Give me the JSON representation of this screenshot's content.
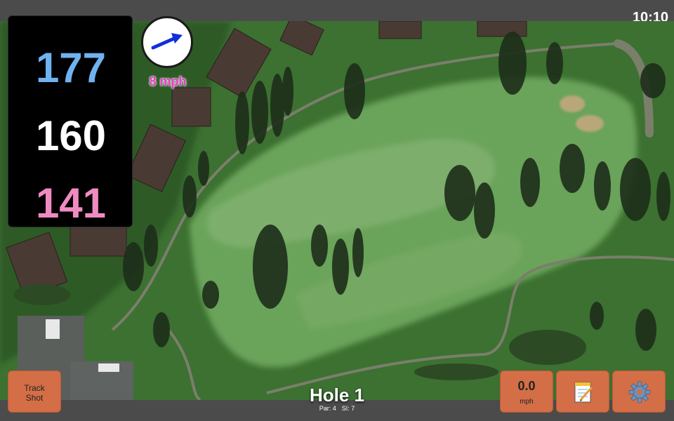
{
  "status_bar": {
    "time": "10:10"
  },
  "distances": {
    "back": "177",
    "middle": "160",
    "front": "141"
  },
  "wind": {
    "speed": "8 mph",
    "arrow_icon": "arrow-right-icon"
  },
  "hole": {
    "title": "Hole 1",
    "par": "Par: 4",
    "stroke_index": "SI: 7"
  },
  "buttons": {
    "track_shot": {
      "line1": "Track",
      "line2": "Shot"
    },
    "speed": {
      "value": "0.0",
      "unit": "mph"
    },
    "notes": {
      "icon": "notepad-icon"
    },
    "settings": {
      "icon": "gear-icon"
    }
  },
  "colors": {
    "back_distance": "#6fb2f0",
    "middle_distance": "#ffffff",
    "front_distance": "#f08bc2",
    "wind_text": "#e83ec8",
    "wind_arrow": "#1030d8",
    "button_bg": "#d46e46",
    "panel_bg": "#000000"
  }
}
